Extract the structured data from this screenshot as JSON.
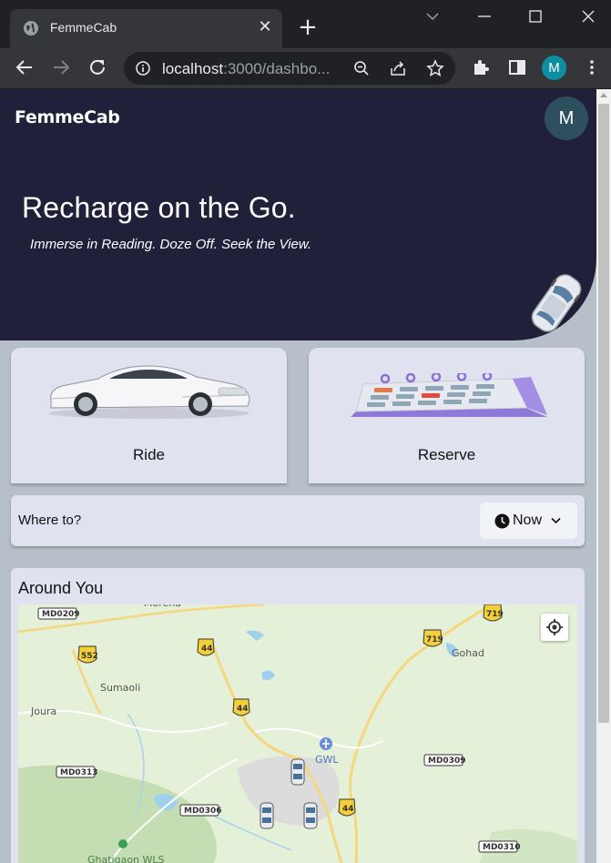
{
  "browser": {
    "tab_title": "FemmeCab",
    "url_host": "localhost",
    "url_rest": ":3000/dashbo...",
    "profile_initial": "M"
  },
  "app": {
    "brand": "FemmeCab",
    "avatar_initial": "M",
    "hero_title": "Recharge on the Go.",
    "hero_subtitle": "Immerse in Reading. Doze Off. Seek the View.",
    "services": [
      {
        "label": "Ride",
        "icon": "car-image"
      },
      {
        "label": "Reserve",
        "icon": "calendar-image"
      }
    ],
    "where_to": "Where to?",
    "time_select": "Now",
    "around_title": "Around You"
  },
  "map": {
    "labels": [
      "Morena",
      "Sumaoli",
      "Joura",
      "Gohad",
      "GWL",
      "Ghatigaon WLS"
    ],
    "shields": [
      "MD0209",
      "552",
      "44",
      "719",
      "44",
      "MD0313",
      "MD0306",
      "MD0309",
      "44",
      "MD0310"
    ]
  },
  "colors": {
    "hero_bg": "#20203a",
    "card_bg": "#e1e2f0",
    "page_bg": "#b7c0c8",
    "avatar_bg": "#2d4f5e",
    "profile_bg": "#0e8ea2"
  }
}
